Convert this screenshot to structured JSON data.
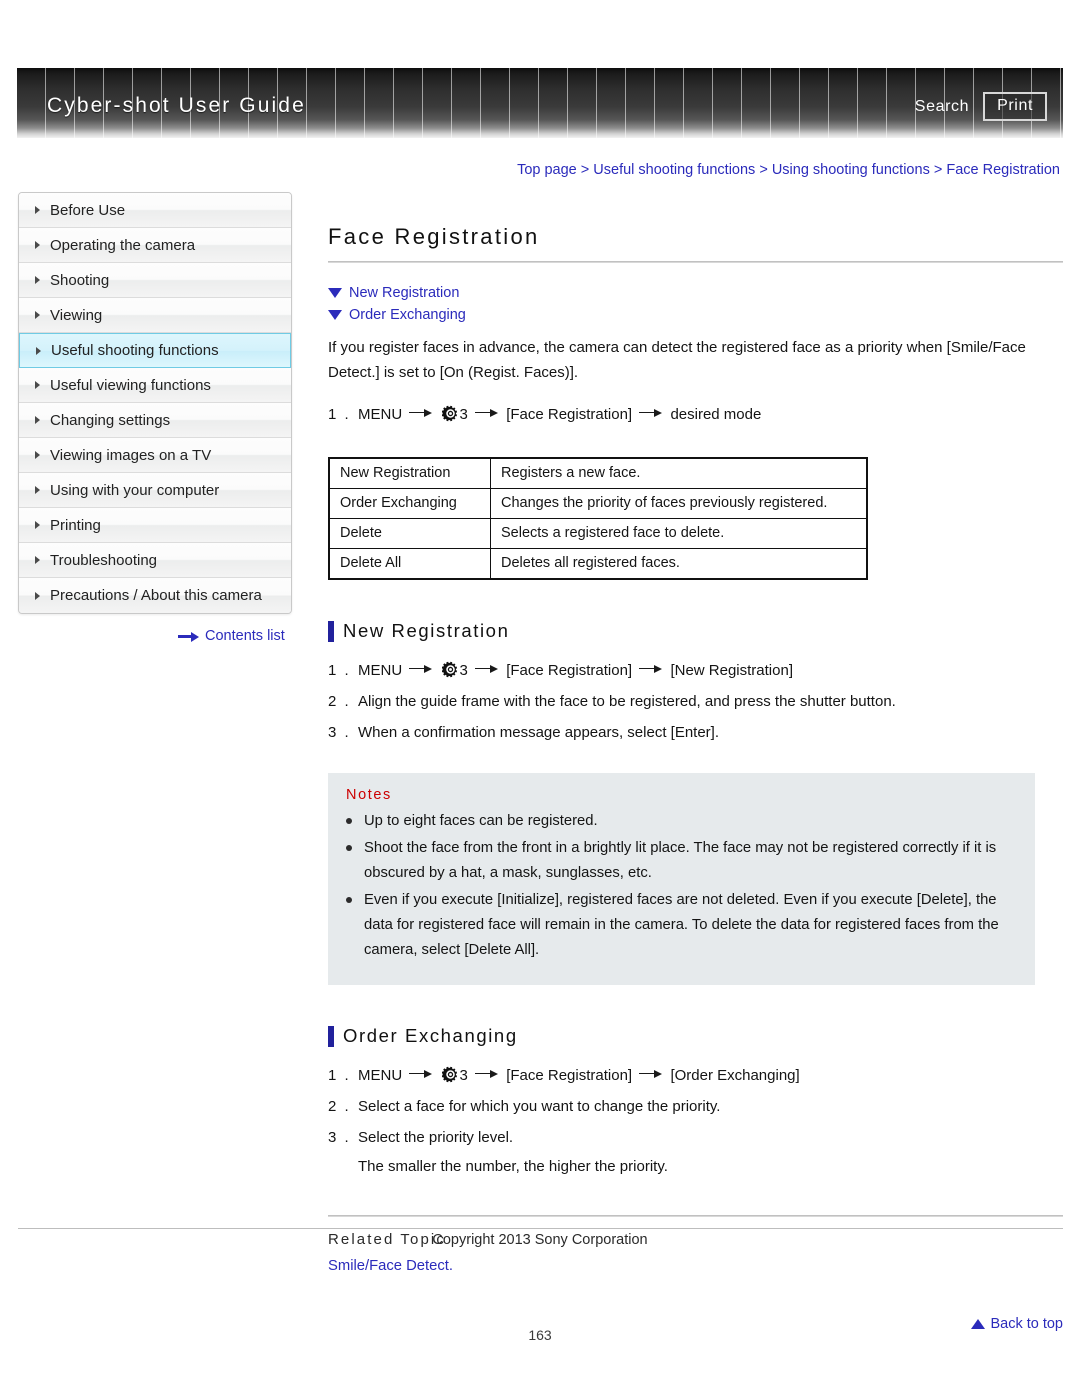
{
  "header": {
    "title": "Cyber-shot User Guide",
    "search_label": "Search",
    "print_label": "Print"
  },
  "breadcrumb": {
    "items": [
      "Top page",
      "Useful shooting functions",
      "Using shooting functions",
      "Face Registration"
    ],
    "separator": ">"
  },
  "sidebar": {
    "items": [
      {
        "label": "Before Use",
        "active": false
      },
      {
        "label": "Operating the camera",
        "active": false
      },
      {
        "label": "Shooting",
        "active": false
      },
      {
        "label": "Viewing",
        "active": false
      },
      {
        "label": "Useful shooting functions",
        "active": true
      },
      {
        "label": "Useful viewing functions",
        "active": false
      },
      {
        "label": "Changing settings",
        "active": false
      },
      {
        "label": "Viewing images on a TV",
        "active": false
      },
      {
        "label": "Using with your computer",
        "active": false
      },
      {
        "label": "Printing",
        "active": false
      },
      {
        "label": "Troubleshooting",
        "active": false
      },
      {
        "label": "Precautions / About this camera",
        "active": false
      }
    ],
    "contents_list_label": "Contents list"
  },
  "main": {
    "page_title": "Face Registration",
    "jump_links": [
      {
        "label": "New Registration"
      },
      {
        "label": "Order Exchanging"
      }
    ],
    "intro": "If you register faces in advance, the camera can detect the registered face as a priority when [Smile/Face Detect.] is set to [On (Regist. Faces)].",
    "intro_step": {
      "num": "1 .",
      "part1": "MENU",
      "gear_number": "3",
      "part2": "[Face Registration]",
      "part3": "desired mode"
    },
    "table": {
      "rows": [
        {
          "name": "New Registration",
          "desc": "Registers a new face."
        },
        {
          "name": "Order Exchanging",
          "desc": "Changes the priority of faces previously registered."
        },
        {
          "name": "Delete",
          "desc": "Selects a registered face to delete."
        },
        {
          "name": "Delete All",
          "desc": "Deletes all registered faces."
        }
      ]
    },
    "new_registration": {
      "heading": "New Registration",
      "step1": {
        "num": "1 .",
        "part1": "MENU",
        "gear_number": "3",
        "part2": "[Face Registration]",
        "part3": "[New Registration]"
      },
      "step2": {
        "num": "2 .",
        "text": "Align the guide frame with the face to be registered, and press the shutter button."
      },
      "step3": {
        "num": "3 .",
        "text": "When a confirmation message appears, select [Enter]."
      }
    },
    "notes": {
      "title": "Notes",
      "items": [
        "Up to eight faces can be registered.",
        "Shoot the face from the front in a brightly lit place. The face may not be registered correctly if it is obscured by a hat, a mask, sunglasses, etc.",
        "Even if you execute [Initialize], registered faces are not deleted. Even if you execute [Delete], the data for registered face will remain in the camera. To delete the data for registered faces from the camera, select [Delete All]."
      ]
    },
    "order_exchanging": {
      "heading": "Order Exchanging",
      "step1": {
        "num": "1 .",
        "part1": "MENU",
        "gear_number": "3",
        "part2": "[Face Registration]",
        "part3": "[Order Exchanging]"
      },
      "step2": {
        "num": "2 .",
        "text": "Select a face for which you want to change the priority."
      },
      "step3": {
        "num": "3 .",
        "text": "Select the priority level."
      },
      "step3_sub": "The smaller the number, the higher the priority."
    },
    "related": {
      "title": "Related Topic",
      "link": "Smile/Face Detect."
    },
    "back_to_top": "Back to top"
  },
  "footer": {
    "copyright": "Copyright 2013 Sony Corporation",
    "page_number": "163"
  }
}
